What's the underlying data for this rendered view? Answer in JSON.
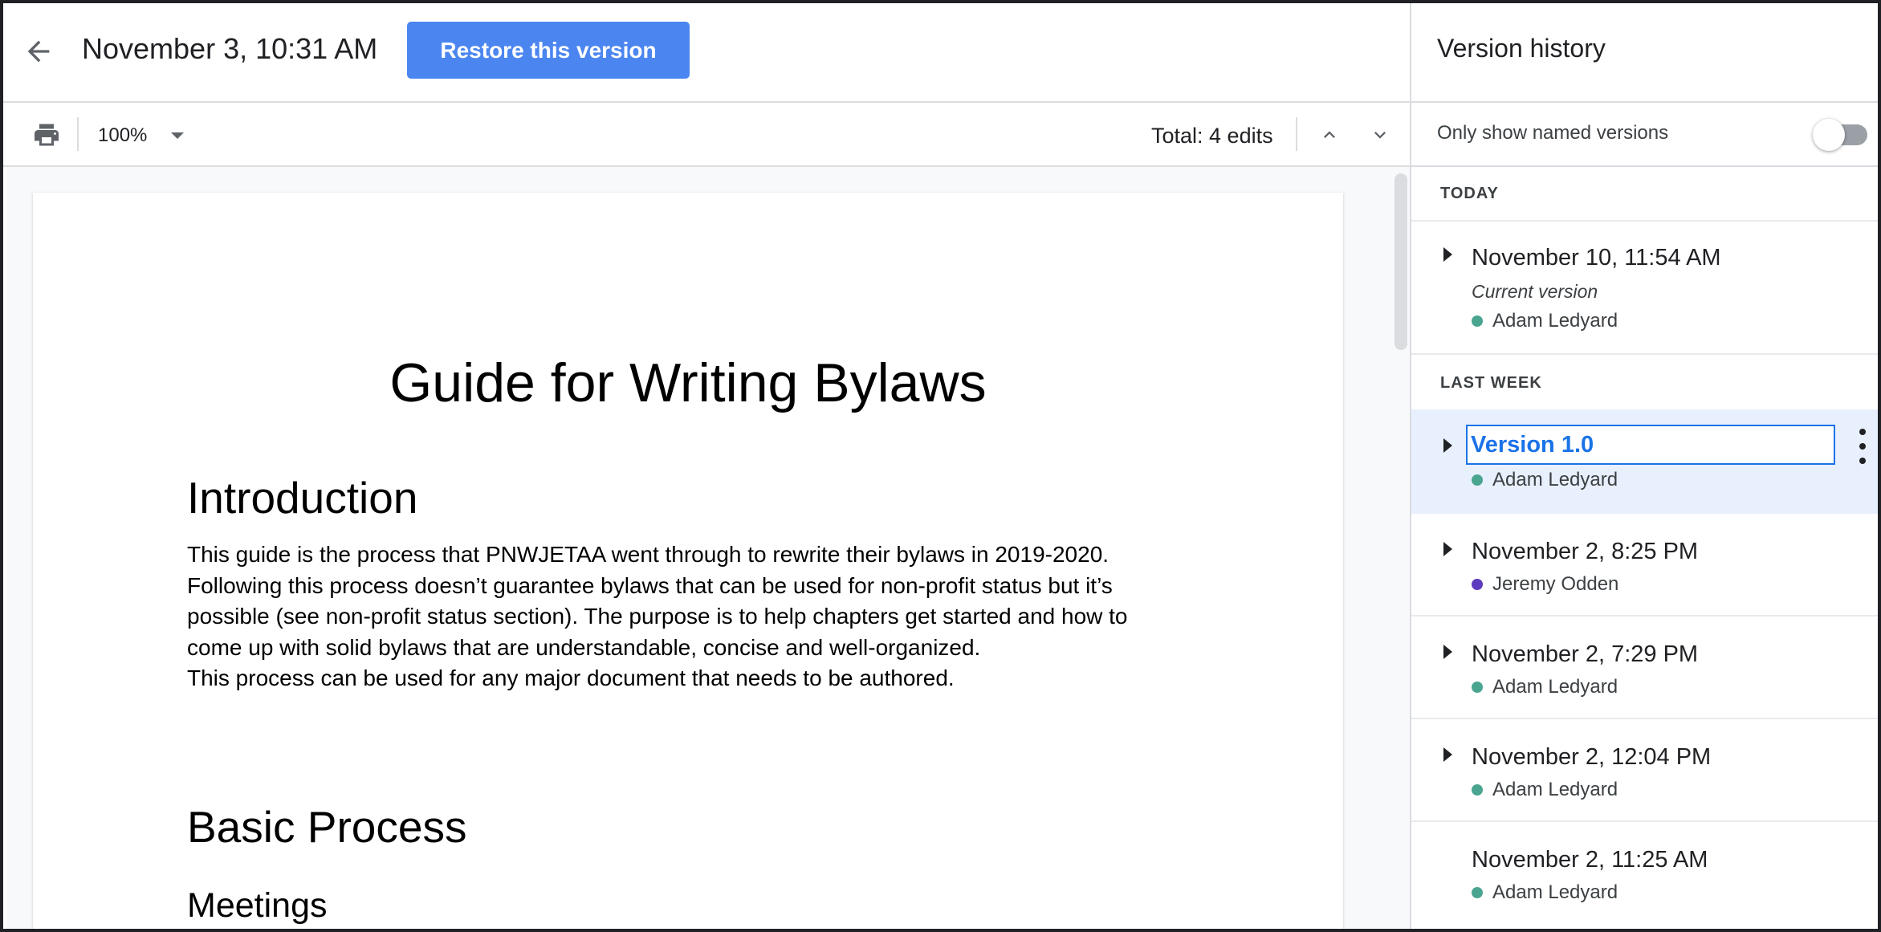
{
  "header": {
    "title": "November 3, 10:31 AM",
    "restore_label": "Restore this version"
  },
  "toolbar": {
    "zoom": "100%",
    "edits": "Total: 4 edits"
  },
  "document": {
    "title": "Guide for Writing Bylaws",
    "intro_heading": "Introduction",
    "intro_para": "This guide is the process that PNWJETAA went through to rewrite their bylaws in 2019-2020.\nFollowing this process doesn’t guarantee bylaws that can be used for non-profit status but it’s\npossible (see non-profit status section). The purpose is to help chapters get started and how to\ncome up with solid bylaws that are understandable, concise and well-organized.",
    "intro_para2": "This process can be used for any major document that needs to be authored.",
    "process_heading": "Basic Process",
    "meetings_heading": "Meetings"
  },
  "panel": {
    "title": "Version history",
    "filter_label": "Only show named versions",
    "sections": {
      "today": "TODAY",
      "last_week": "LAST WEEK"
    },
    "versions": [
      {
        "date": "November 10, 11:54 AM",
        "subtitle": "Current version",
        "author": "Adam Ledyard",
        "color": "#4aa590"
      },
      {
        "name": "Version 1.0",
        "author": "Adam Ledyard",
        "color": "#4aa590"
      },
      {
        "date": "November 2, 8:25 PM",
        "author": "Jeremy Odden",
        "color": "#5c3bbf"
      },
      {
        "date": "November 2, 7:29 PM",
        "author": "Adam Ledyard",
        "color": "#4aa590"
      },
      {
        "date": "November 2, 12:04 PM",
        "author": "Adam Ledyard",
        "color": "#4aa590"
      },
      {
        "date": "November 2, 11:25 AM",
        "author": "Adam Ledyard",
        "color": "#4aa590"
      }
    ]
  },
  "colors": {
    "accent": "#4b86f0",
    "selected_bg": "#e8f0fe",
    "link_blue": "#1a73e8"
  },
  "icons": [
    "back-arrow-icon",
    "print-icon",
    "chevron-down-icon",
    "chevron-up-icon",
    "more-vert-icon",
    "caret-right-icon"
  ]
}
